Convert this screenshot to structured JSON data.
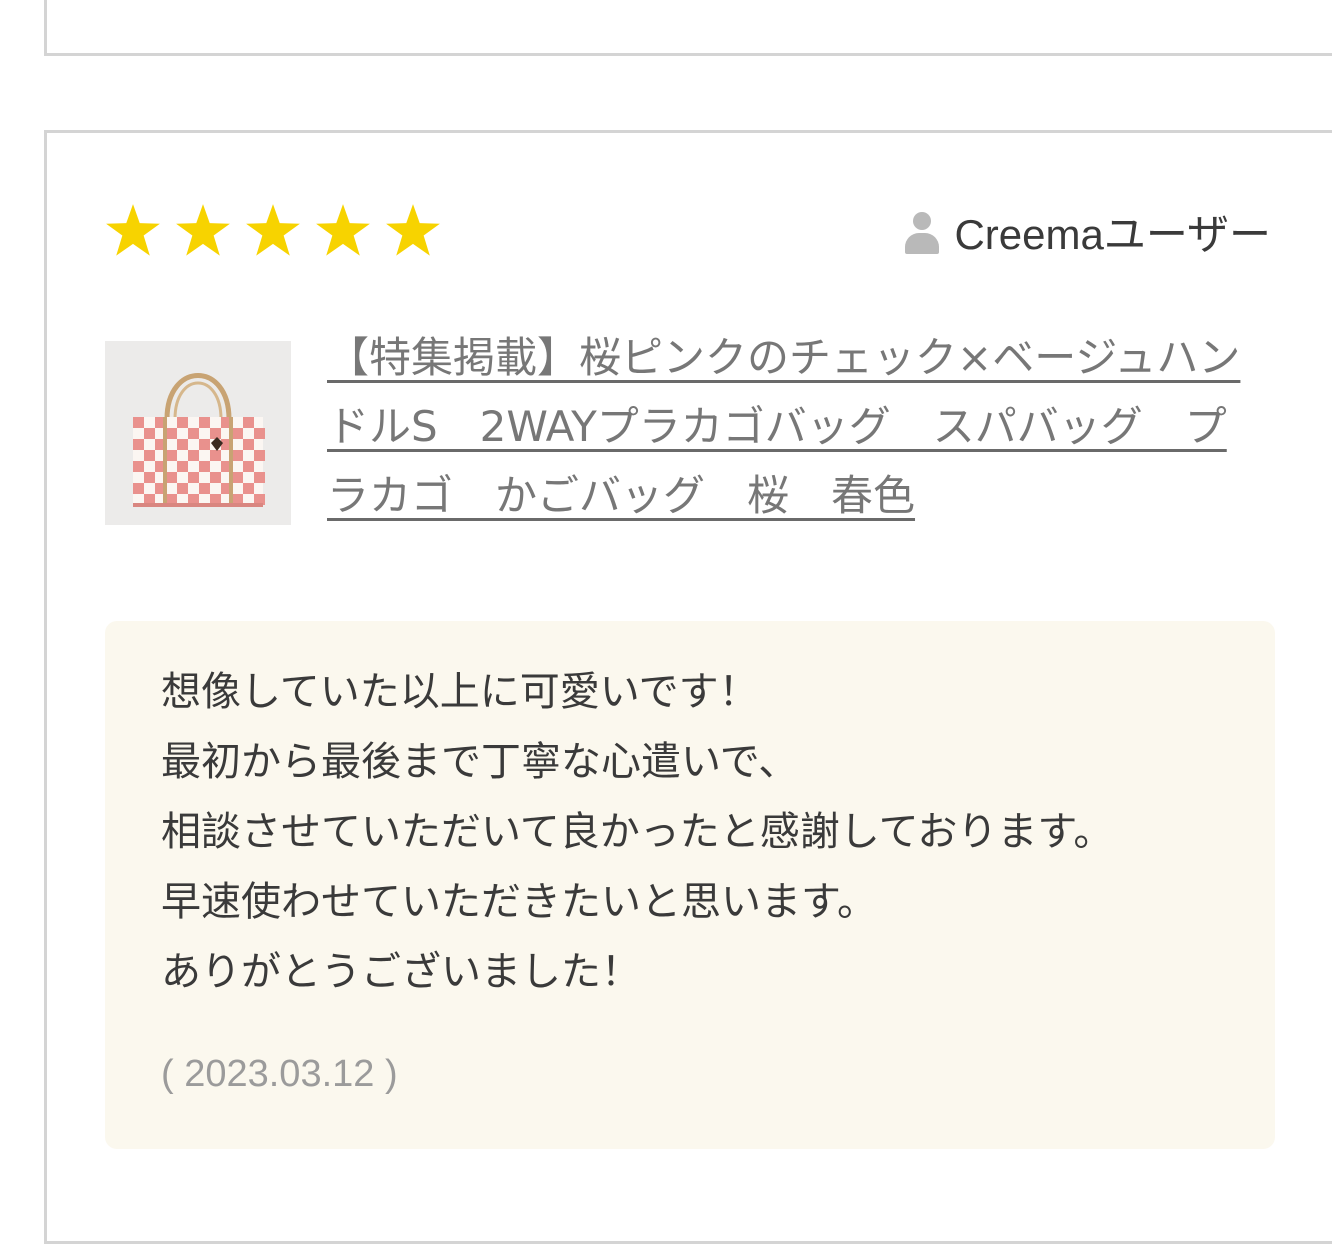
{
  "review": {
    "rating": 5,
    "max_rating": 5,
    "star_color": "#f7d300",
    "user_icon": "user-icon",
    "user_name": "Creemaユーザー",
    "product": {
      "title": "【特集掲載】桜ピンクのチェック×ベージュハンドルS　2WAYプラカゴバッグ　スパバッグ　プラカゴ　かごバッグ　桜　春色",
      "thumbnail_colors": {
        "pink": "#e9918d",
        "white": "#fbf6f2",
        "handle": "#c8a373",
        "background": "#ecebea"
      }
    },
    "comment": "想像していた以上に可愛いです！\n最初から最後まで丁寧な心遣いで、\n相談させていただいて良かったと感謝しております。\n早速使わせていただきたいと思います。\nありがとうございました！",
    "date": "( 2023.03.12 )"
  }
}
